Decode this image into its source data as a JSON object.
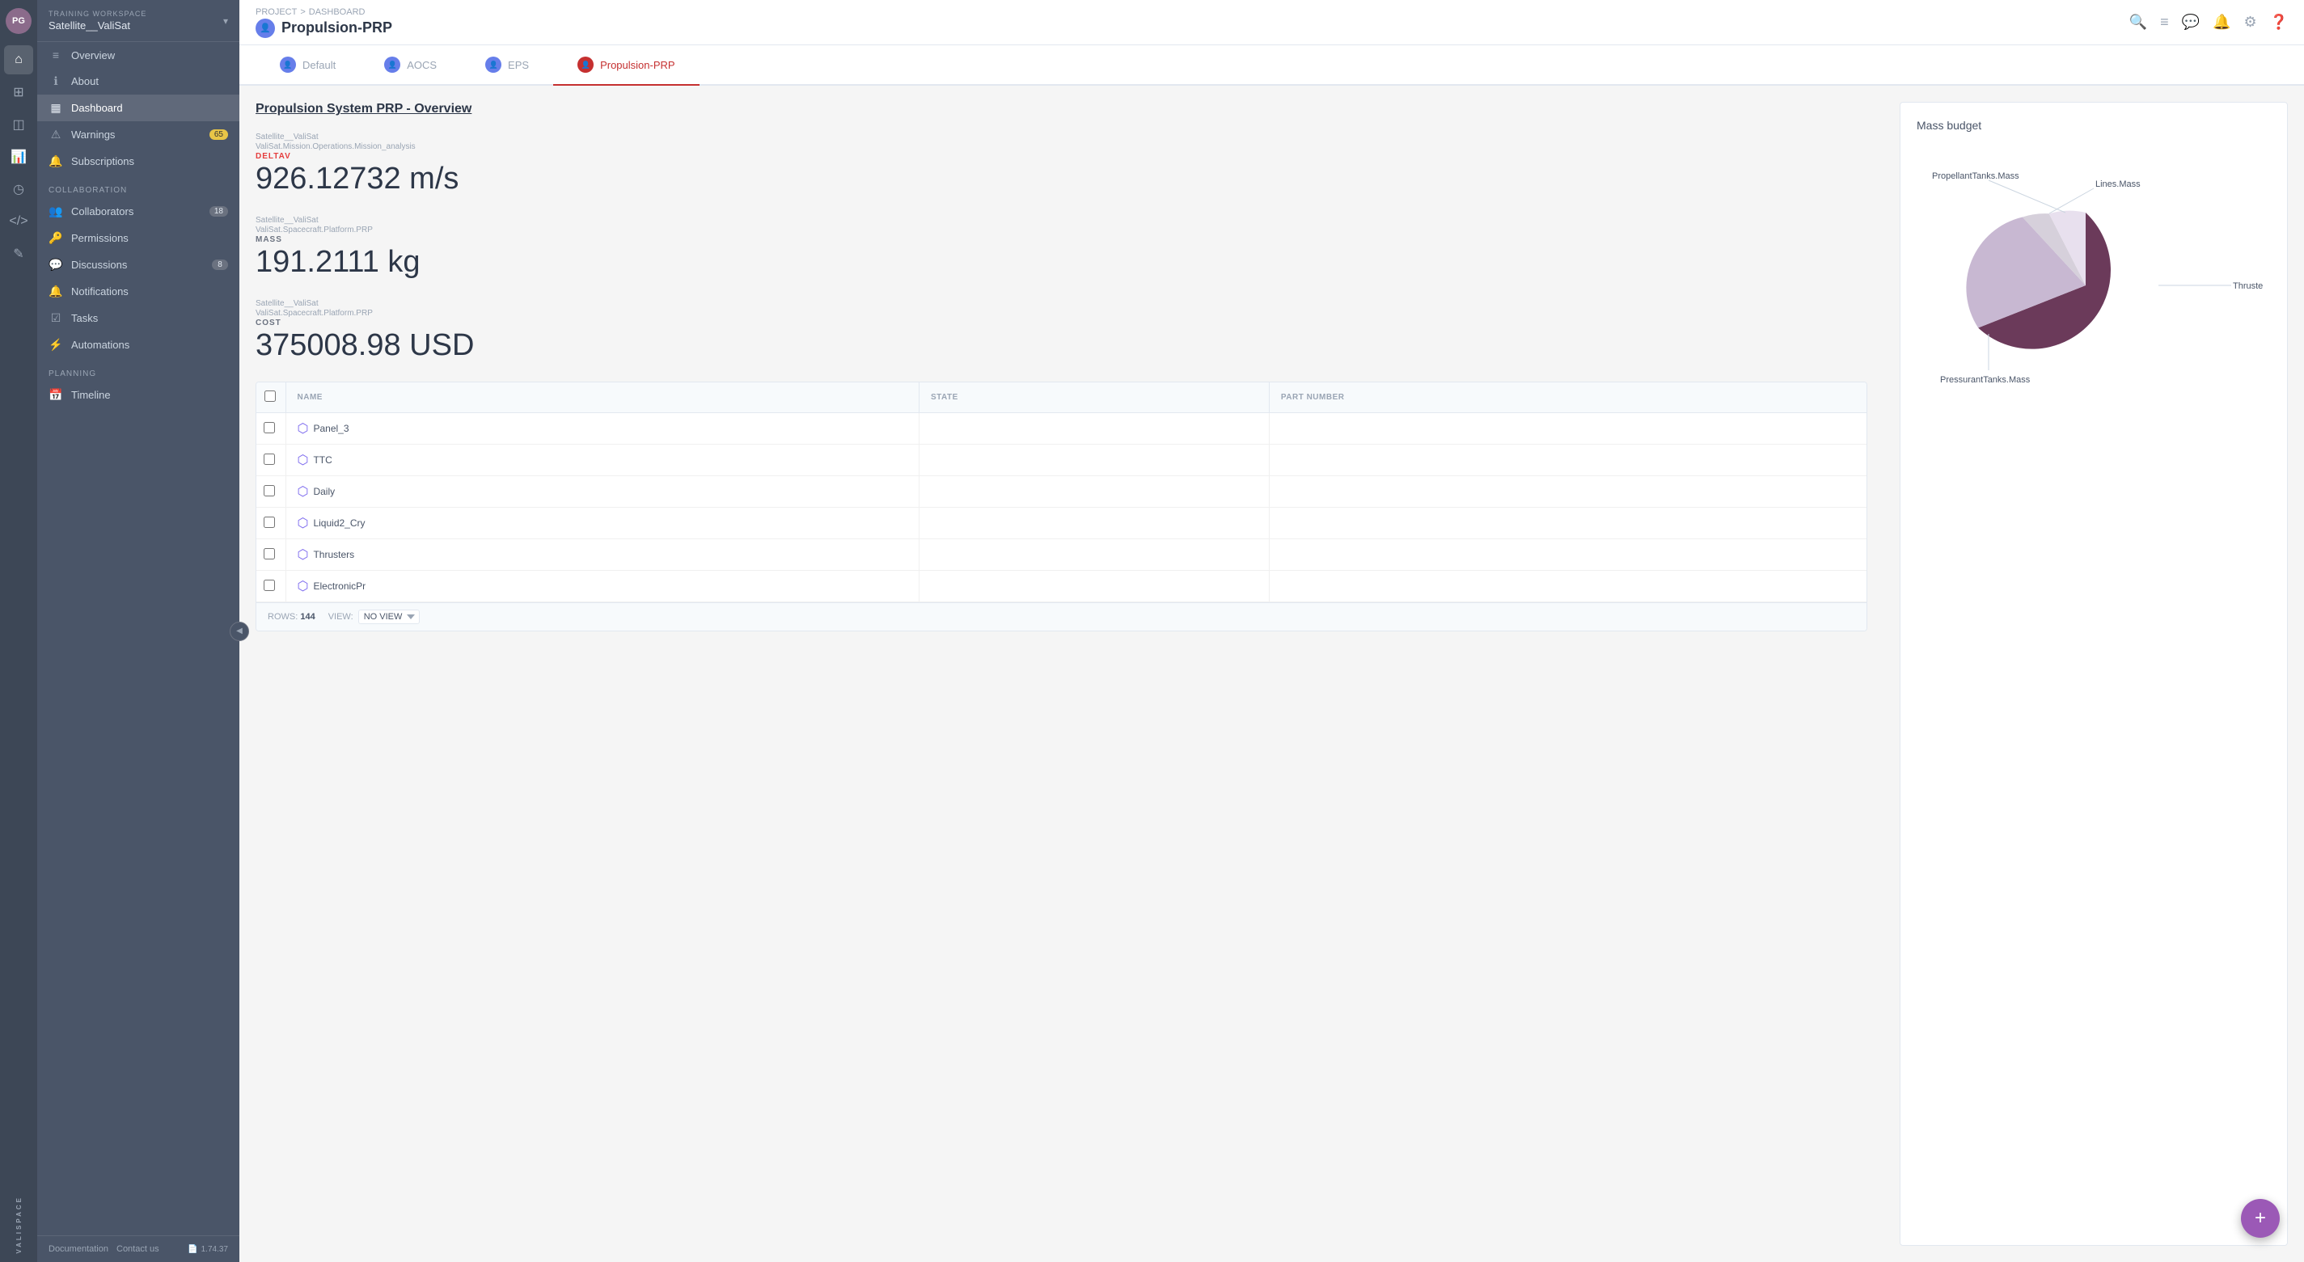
{
  "app": {
    "avatar": "PG",
    "workspace_label": "TRAINING WORKSPACE",
    "workspace_name": "Satellite__ValiSat"
  },
  "nav_icons": [
    {
      "name": "home-icon",
      "symbol": "⌂",
      "active": true
    },
    {
      "name": "grid-icon",
      "symbol": "⊞",
      "active": false
    },
    {
      "name": "file-icon",
      "symbol": "📄",
      "active": false
    },
    {
      "name": "chart-icon",
      "symbol": "📊",
      "active": false
    },
    {
      "name": "clock-icon",
      "symbol": "◷",
      "active": false
    },
    {
      "name": "code-icon",
      "symbol": "</>",
      "active": false
    },
    {
      "name": "pen-icon",
      "symbol": "✏",
      "active": false
    }
  ],
  "sidebar": {
    "sections": [
      {
        "label": "",
        "items": [
          {
            "id": "overview",
            "label": "Overview",
            "icon": "≡",
            "active": false,
            "badge": null
          },
          {
            "id": "about",
            "label": "About",
            "icon": "ℹ",
            "active": false,
            "badge": null
          },
          {
            "id": "dashboard",
            "label": "Dashboard",
            "icon": "▦",
            "active": true,
            "badge": null
          },
          {
            "id": "warnings",
            "label": "Warnings",
            "icon": "⚠",
            "active": false,
            "badge": "65"
          },
          {
            "id": "subscriptions",
            "label": "Subscriptions",
            "icon": "🔔",
            "active": false,
            "badge": null
          }
        ]
      },
      {
        "label": "Collaboration",
        "items": [
          {
            "id": "collaborators",
            "label": "Collaborators",
            "icon": "👥",
            "active": false,
            "badge": "18"
          },
          {
            "id": "permissions",
            "label": "Permissions",
            "icon": "🔑",
            "active": false,
            "badge": null
          },
          {
            "id": "discussions",
            "label": "Discussions",
            "icon": "💬",
            "active": false,
            "badge": "8"
          },
          {
            "id": "notifications",
            "label": "Notifications",
            "icon": "🔔",
            "active": false,
            "badge": null
          },
          {
            "id": "tasks",
            "label": "Tasks",
            "icon": "☑",
            "active": false,
            "badge": null
          },
          {
            "id": "automations",
            "label": "Automations",
            "icon": "⚡",
            "active": false,
            "badge": null
          }
        ]
      },
      {
        "label": "Planning",
        "items": [
          {
            "id": "timeline",
            "label": "Timeline",
            "icon": "📅",
            "active": false,
            "badge": null
          }
        ]
      }
    ],
    "footer": {
      "doc_link": "Documentation",
      "contact_link": "Contact us",
      "version": "1.74.37",
      "version_icon": "📄"
    }
  },
  "header": {
    "breadcrumb_project": "PROJECT",
    "breadcrumb_sep": ">",
    "breadcrumb_dashboard": "DASHBOARD",
    "title": "Propulsion-PRP",
    "title_icon": "👤"
  },
  "tabs": [
    {
      "id": "default",
      "label": "Default",
      "icon": "👤",
      "active": false
    },
    {
      "id": "aocs",
      "label": "AOCS",
      "icon": "👤",
      "active": false
    },
    {
      "id": "eps",
      "label": "EPS",
      "icon": "👤",
      "active": false
    },
    {
      "id": "propulsion-prp",
      "label": "Propulsion-PRP",
      "icon": "👤",
      "active": true
    }
  ],
  "main": {
    "page_subtitle": "Propulsion System PRP - Overview",
    "stats": [
      {
        "path1": "Satellite__ValiSat",
        "path2": "ValiSat.Mission.Operations.Mission_analysis",
        "label": "DELTAV",
        "value": "926.12732 m/s"
      },
      {
        "path1": "Satellite__ValiSat",
        "path2": "ValiSat.Spacecraft.Platform.PRP",
        "label": "MASS",
        "value": "191.2111 kg"
      },
      {
        "path1": "Satellite__ValiSat",
        "path2": "ValiSat.Spacecraft.Platform.PRP",
        "label": "COST",
        "value": "375008.98 USD"
      }
    ],
    "table": {
      "columns": [
        {
          "id": "checkbox",
          "label": ""
        },
        {
          "id": "name",
          "label": "NAME"
        },
        {
          "id": "state",
          "label": "STATE"
        },
        {
          "id": "part_number",
          "label": "PART NUMBER"
        }
      ],
      "rows": [
        {
          "name": "Panel_3",
          "state": "",
          "part_number": "",
          "icon": "cube"
        },
        {
          "name": "TTC",
          "state": "",
          "part_number": "",
          "icon": "cube"
        },
        {
          "name": "Daily",
          "state": "",
          "part_number": "",
          "icon": "cube"
        },
        {
          "name": "Liquid2_Cry",
          "state": "",
          "part_number": "",
          "icon": "cube"
        },
        {
          "name": "Thrusters",
          "state": "",
          "part_number": "",
          "icon": "cube"
        },
        {
          "name": "ElectronicPr",
          "state": "",
          "part_number": "",
          "icon": "cube"
        }
      ],
      "rows_count": "144",
      "view_label": "VIEW:",
      "view_value": "NO VIEW",
      "rows_label": "ROWS:"
    }
  },
  "chart": {
    "title": "Mass budget",
    "segments": [
      {
        "label": "Lines.Mass",
        "color": "#d6d0db",
        "percent": 5
      },
      {
        "label": "PropellantTanks.Mass",
        "color": "#e8e0ee",
        "percent": 18
      },
      {
        "label": "ThrusterEngineAssembly.Mass",
        "color": "#6b3a5a",
        "percent": 50
      },
      {
        "label": "PressurantTanks.Mass",
        "color": "#c8b8d2",
        "percent": 27
      }
    ]
  },
  "fab": {
    "label": "+"
  }
}
